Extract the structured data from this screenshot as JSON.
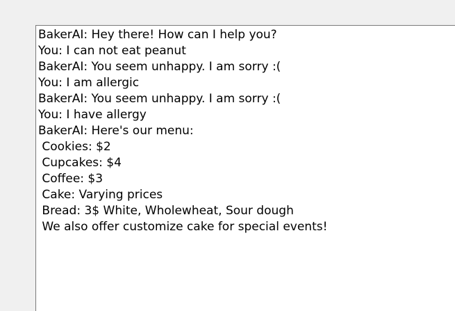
{
  "chat": {
    "lines": [
      "BakerAI: Hey there! How can I help you?",
      "You: I can not eat peanut",
      "BakerAI: You seem unhappy. I am sorry :(",
      "You: I am allergic",
      "BakerAI: You seem unhappy. I am sorry :(",
      "You: I have allergy",
      "BakerAI: Here's our menu:",
      " Cookies: $2",
      " Cupcakes: $4",
      " Coffee: $3",
      " Cake: Varying prices",
      " Bread: 3$ White, Wholewheat, Sour dough",
      " We also offer customize cake for special events!"
    ]
  }
}
